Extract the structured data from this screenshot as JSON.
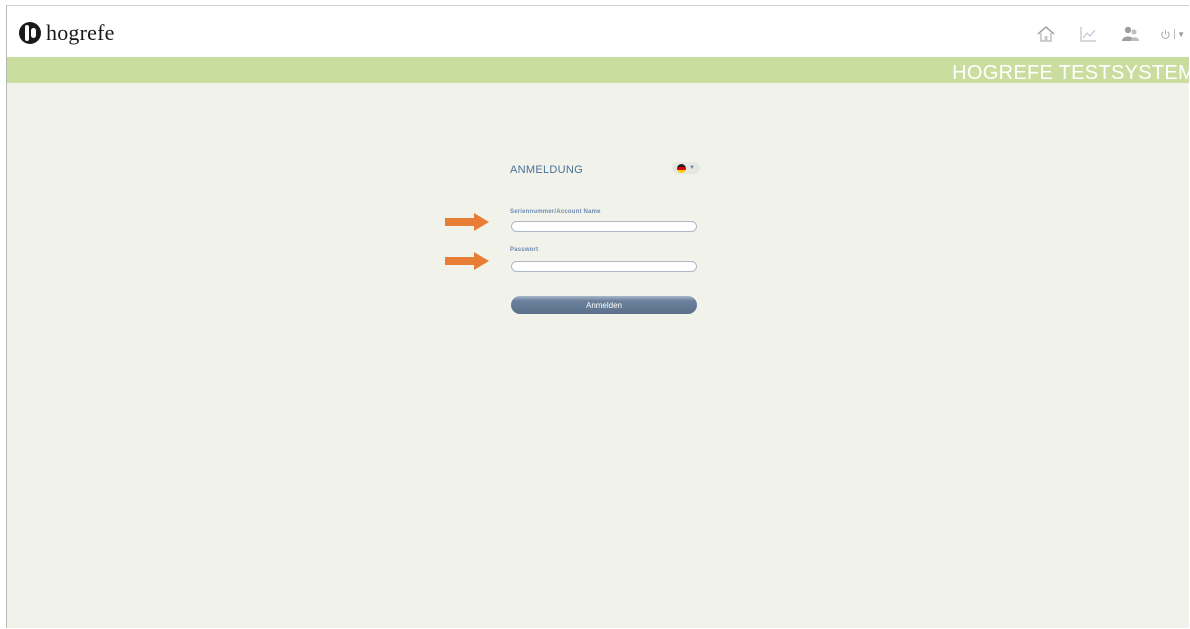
{
  "header": {
    "logo_text": "hogrefe",
    "icons": [
      "home-icon",
      "chart-icon",
      "users-icon",
      "power-icon"
    ],
    "colors": {
      "banner": "#c9de9e",
      "background": "#f1f3ea",
      "accent": "#4b6f9a",
      "arrow": "#e87d35"
    }
  },
  "banner": {
    "title": "HOGREFE TESTSYSTEM"
  },
  "login": {
    "title": "ANMELDUNG",
    "language": {
      "selected_flag": "de-flag-icon"
    },
    "account_label": "Seriennummer/Account Name",
    "account_value": "",
    "password_label": "Passwort",
    "password_value": "",
    "submit_label": "Anmelden"
  }
}
